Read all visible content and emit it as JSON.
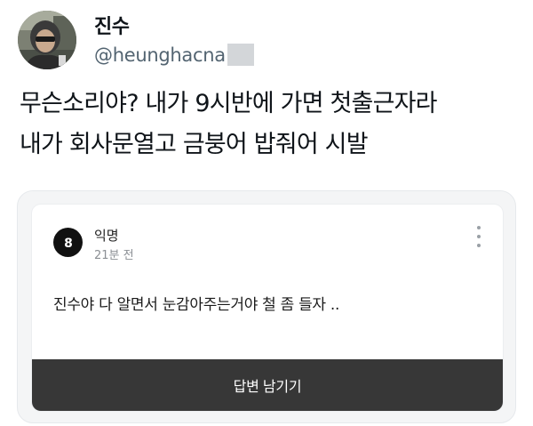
{
  "author": {
    "display_name": "진수",
    "handle": "@heunghacna"
  },
  "tweet": {
    "lines": [
      "무슨소리야? 내가 9시반에 가면 첫출근자라",
      "내가 회사문열고 금붕어 밥줘어 시발"
    ]
  },
  "embedded_post": {
    "author_name": "익명",
    "time_ago": "21분 전",
    "body": "진수야 다 알면서 눈감아주는거야 철 좀 들자 ..",
    "reply_label": "답변 남기기"
  }
}
